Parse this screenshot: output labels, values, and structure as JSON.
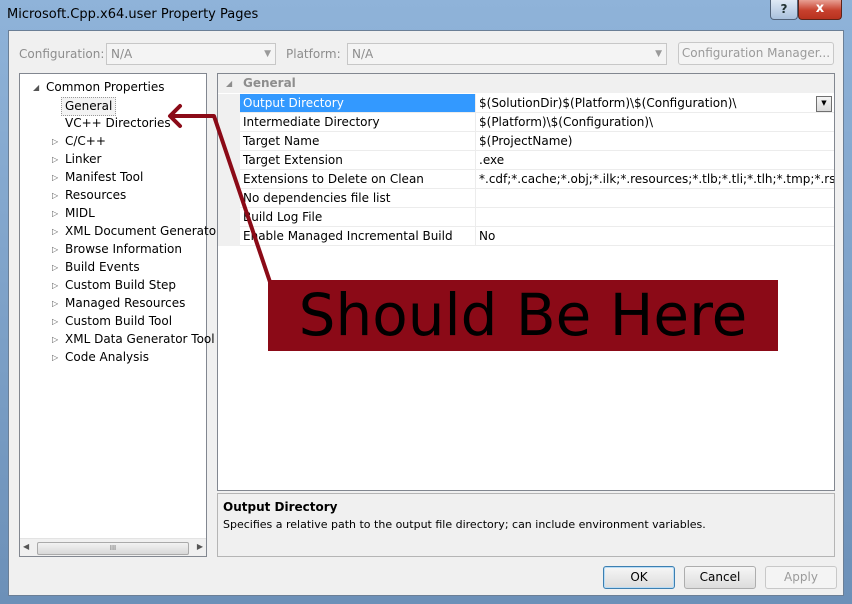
{
  "window": {
    "title": "Microsoft.Cpp.x64.user Property Pages",
    "close_glyph": "x",
    "help_glyph": "?"
  },
  "toolbar": {
    "configuration_label": "Configuration:",
    "configuration_value": "N/A",
    "platform_label": "Platform:",
    "platform_value": "N/A",
    "config_manager_label": "Configuration Manager..."
  },
  "tree": {
    "root": "Common Properties",
    "items": [
      {
        "label": "General",
        "selected": true,
        "expandable": false
      },
      {
        "label": "VC++ Directories",
        "expandable": false
      },
      {
        "label": "C/C++",
        "expandable": true
      },
      {
        "label": "Linker",
        "expandable": true
      },
      {
        "label": "Manifest Tool",
        "expandable": true
      },
      {
        "label": "Resources",
        "expandable": true
      },
      {
        "label": "MIDL",
        "expandable": true
      },
      {
        "label": "XML Document Generator",
        "expandable": true
      },
      {
        "label": "Browse Information",
        "expandable": true
      },
      {
        "label": "Build Events",
        "expandable": true
      },
      {
        "label": "Custom Build Step",
        "expandable": true
      },
      {
        "label": "Managed Resources",
        "expandable": true
      },
      {
        "label": "Custom Build Tool",
        "expandable": true
      },
      {
        "label": "XML Data Generator Tool",
        "expandable": true
      },
      {
        "label": "Code Analysis",
        "expandable": true
      }
    ],
    "scroll_thumb_glyph": "III"
  },
  "grid": {
    "category": "General",
    "rows": [
      {
        "name": "Output Directory",
        "value": "$(SolutionDir)$(Platform)\\$(Configuration)\\"
      },
      {
        "name": "Intermediate Directory",
        "value": "$(Platform)\\$(Configuration)\\"
      },
      {
        "name": "Target Name",
        "value": "$(ProjectName)"
      },
      {
        "name": "Target Extension",
        "value": ".exe"
      },
      {
        "name": "Extensions to Delete on Clean",
        "value": "*.cdf;*.cache;*.obj;*.ilk;*.resources;*.tlb;*.tli;*.tlh;*.tmp;*.rsp;*.pgc;*.pgd;*.meta"
      },
      {
        "name": "No dependencies file list",
        "value": ""
      },
      {
        "name": "Build Log File",
        "value": ""
      },
      {
        "name": "Enable Managed Incremental Build",
        "value": "No"
      }
    ]
  },
  "description": {
    "title": "Output Directory",
    "text": "Specifies a relative path to the output file directory; can include environment variables."
  },
  "buttons": {
    "ok": "OK",
    "cancel": "Cancel",
    "apply": "Apply"
  },
  "annotation": {
    "text": "Should Be Here",
    "color": "#8b0a17"
  }
}
